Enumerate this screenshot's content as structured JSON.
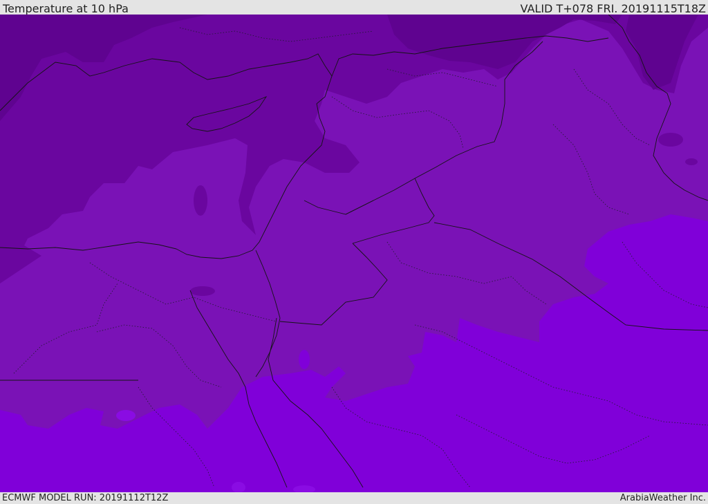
{
  "header": {
    "title": "Temperature at 10 hPa",
    "valid_time": "VALID T+078 FRI. 20191115T18Z"
  },
  "footer": {
    "model_run": "ECMWF MODEL RUN: 20191112T12Z",
    "credit": "ArabiaWeather Inc."
  },
  "map": {
    "colors": {
      "coldest": "#5f0390",
      "cold": "#6a069f",
      "mid": "#7a12b6",
      "warm": "#8000d9",
      "lines": "#141414"
    }
  }
}
